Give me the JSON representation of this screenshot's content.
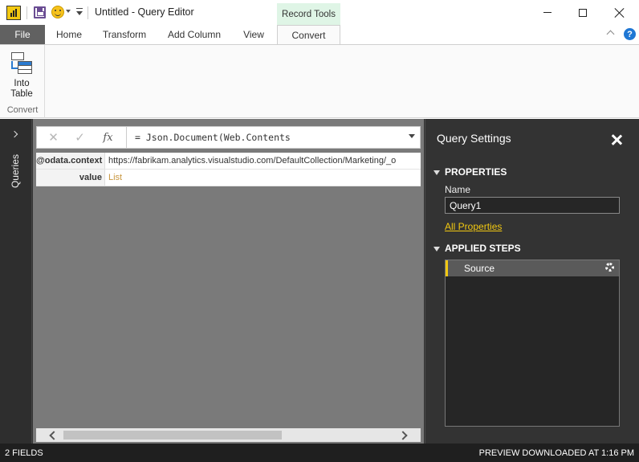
{
  "window": {
    "title": "Untitled - Query Editor",
    "context_tab_header": "Record Tools"
  },
  "tabs": [
    {
      "label": "File"
    },
    {
      "label": "Home"
    },
    {
      "label": "Transform"
    },
    {
      "label": "Add Column"
    },
    {
      "label": "View"
    },
    {
      "label": "Convert",
      "active": true
    }
  ],
  "ribbon": {
    "into_table_line1": "Into",
    "into_table_line2": "Table",
    "group_label": "Convert"
  },
  "queries_pane": {
    "label": "Queries"
  },
  "formula_bar": {
    "fx": "fx",
    "formula": "= Json.Document(Web.Contents"
  },
  "record": {
    "rows": [
      {
        "key": "@odata.context",
        "value": "https://fabrikam.analytics.visualstudio.com/DefaultCollection/Marketing/_o"
      },
      {
        "key": "value",
        "value": "List"
      }
    ]
  },
  "query_settings": {
    "title": "Query Settings",
    "properties_header": "PROPERTIES",
    "name_label": "Name",
    "name_value": "Query1",
    "all_properties": "All Properties",
    "applied_steps_header": "APPLIED STEPS",
    "steps": [
      {
        "label": "Source"
      }
    ]
  },
  "statusbar": {
    "left": "2 FIELDS",
    "right": "PREVIEW DOWNLOADED AT 1:16 PM"
  },
  "colors": {
    "accent_yellow": "#f2c811",
    "context_tab_green": "#dff5e6",
    "file_tab": "#616161",
    "link_value": "#c8963e"
  }
}
